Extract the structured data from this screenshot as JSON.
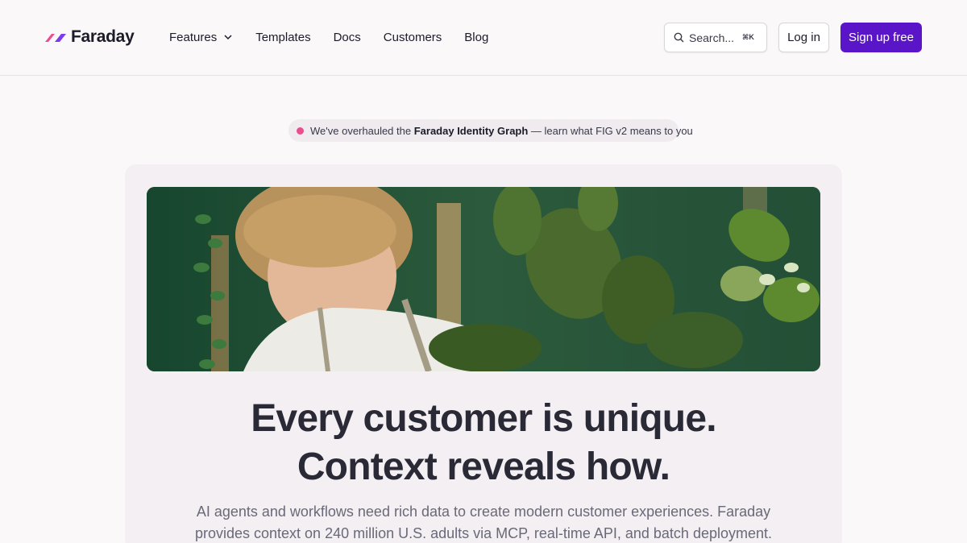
{
  "brand": {
    "name": "Faraday",
    "logo_colors": [
      "#ec4d8f",
      "#7c3aed"
    ]
  },
  "nav": {
    "items": [
      {
        "label": "Features",
        "has_dropdown": true
      },
      {
        "label": "Templates"
      },
      {
        "label": "Docs"
      },
      {
        "label": "Customers"
      },
      {
        "label": "Blog"
      }
    ]
  },
  "search": {
    "label": "Search...",
    "shortcut": "⌘K"
  },
  "auth": {
    "login_label": "Log in",
    "signup_label": "Sign up free"
  },
  "announcement": {
    "prefix": "We've overhauled the ",
    "highlight": "Faraday Identity Graph",
    "suffix": " — learn what FIG v2 means to you"
  },
  "hero": {
    "headline_line1": "Every customer is unique.",
    "headline_line2": "Context reveals how.",
    "subtext": "AI agents and workflows need rich data to create modern customer experiences. Faraday provides context on 240 million U.S. adults via MCP, real-time API, and batch deployment."
  },
  "colors": {
    "accent": "#5b15c9",
    "background": "#faf8f9",
    "card": "#f3eff2",
    "announce_dot": "#ec4d8f"
  }
}
